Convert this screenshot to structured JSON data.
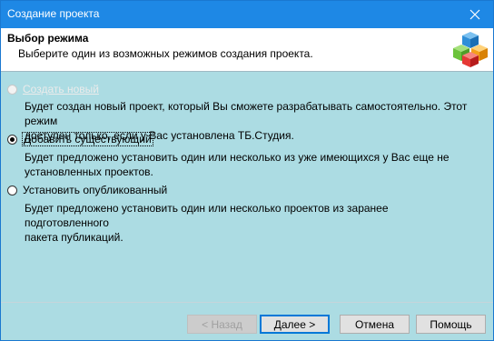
{
  "window": {
    "title": "Создание проекта"
  },
  "header": {
    "title": "Выбор режима",
    "subtitle": "Выберите один из возможных режимов создания проекта."
  },
  "options": [
    {
      "label": "Создать новый",
      "state": "disabled",
      "description_lines": [
        "Будет создан новый проект, который Вы сможете разрабатывать самостоятельно. Этот режим",
        "доступен только, если у Вас установлена ТБ.Студия."
      ]
    },
    {
      "label": "Добавить существующий",
      "state": "checked",
      "description_lines": [
        "Будет предложено установить один или несколько из уже имеющихся у Вас еще не",
        "установленных проектов."
      ]
    },
    {
      "label": "Установить опубликованный",
      "state": "unchecked",
      "description_lines": [
        "Будет предложено установить один или несколько проектов из заранее подготовленного",
        "пакета публикаций."
      ]
    }
  ],
  "buttons": {
    "back": "< Назад",
    "next": "Далее >",
    "cancel": "Отмена",
    "help": "Помощь"
  },
  "icons": {
    "close": "close-icon",
    "logo": "cubes-icon"
  },
  "colors": {
    "titlebar": "#1e88e5",
    "body": "#acdce3",
    "cube_blue": "#2f8fd8",
    "cube_green": "#6cc33b",
    "cube_orange": "#f4a01c",
    "cube_red": "#e53935"
  }
}
